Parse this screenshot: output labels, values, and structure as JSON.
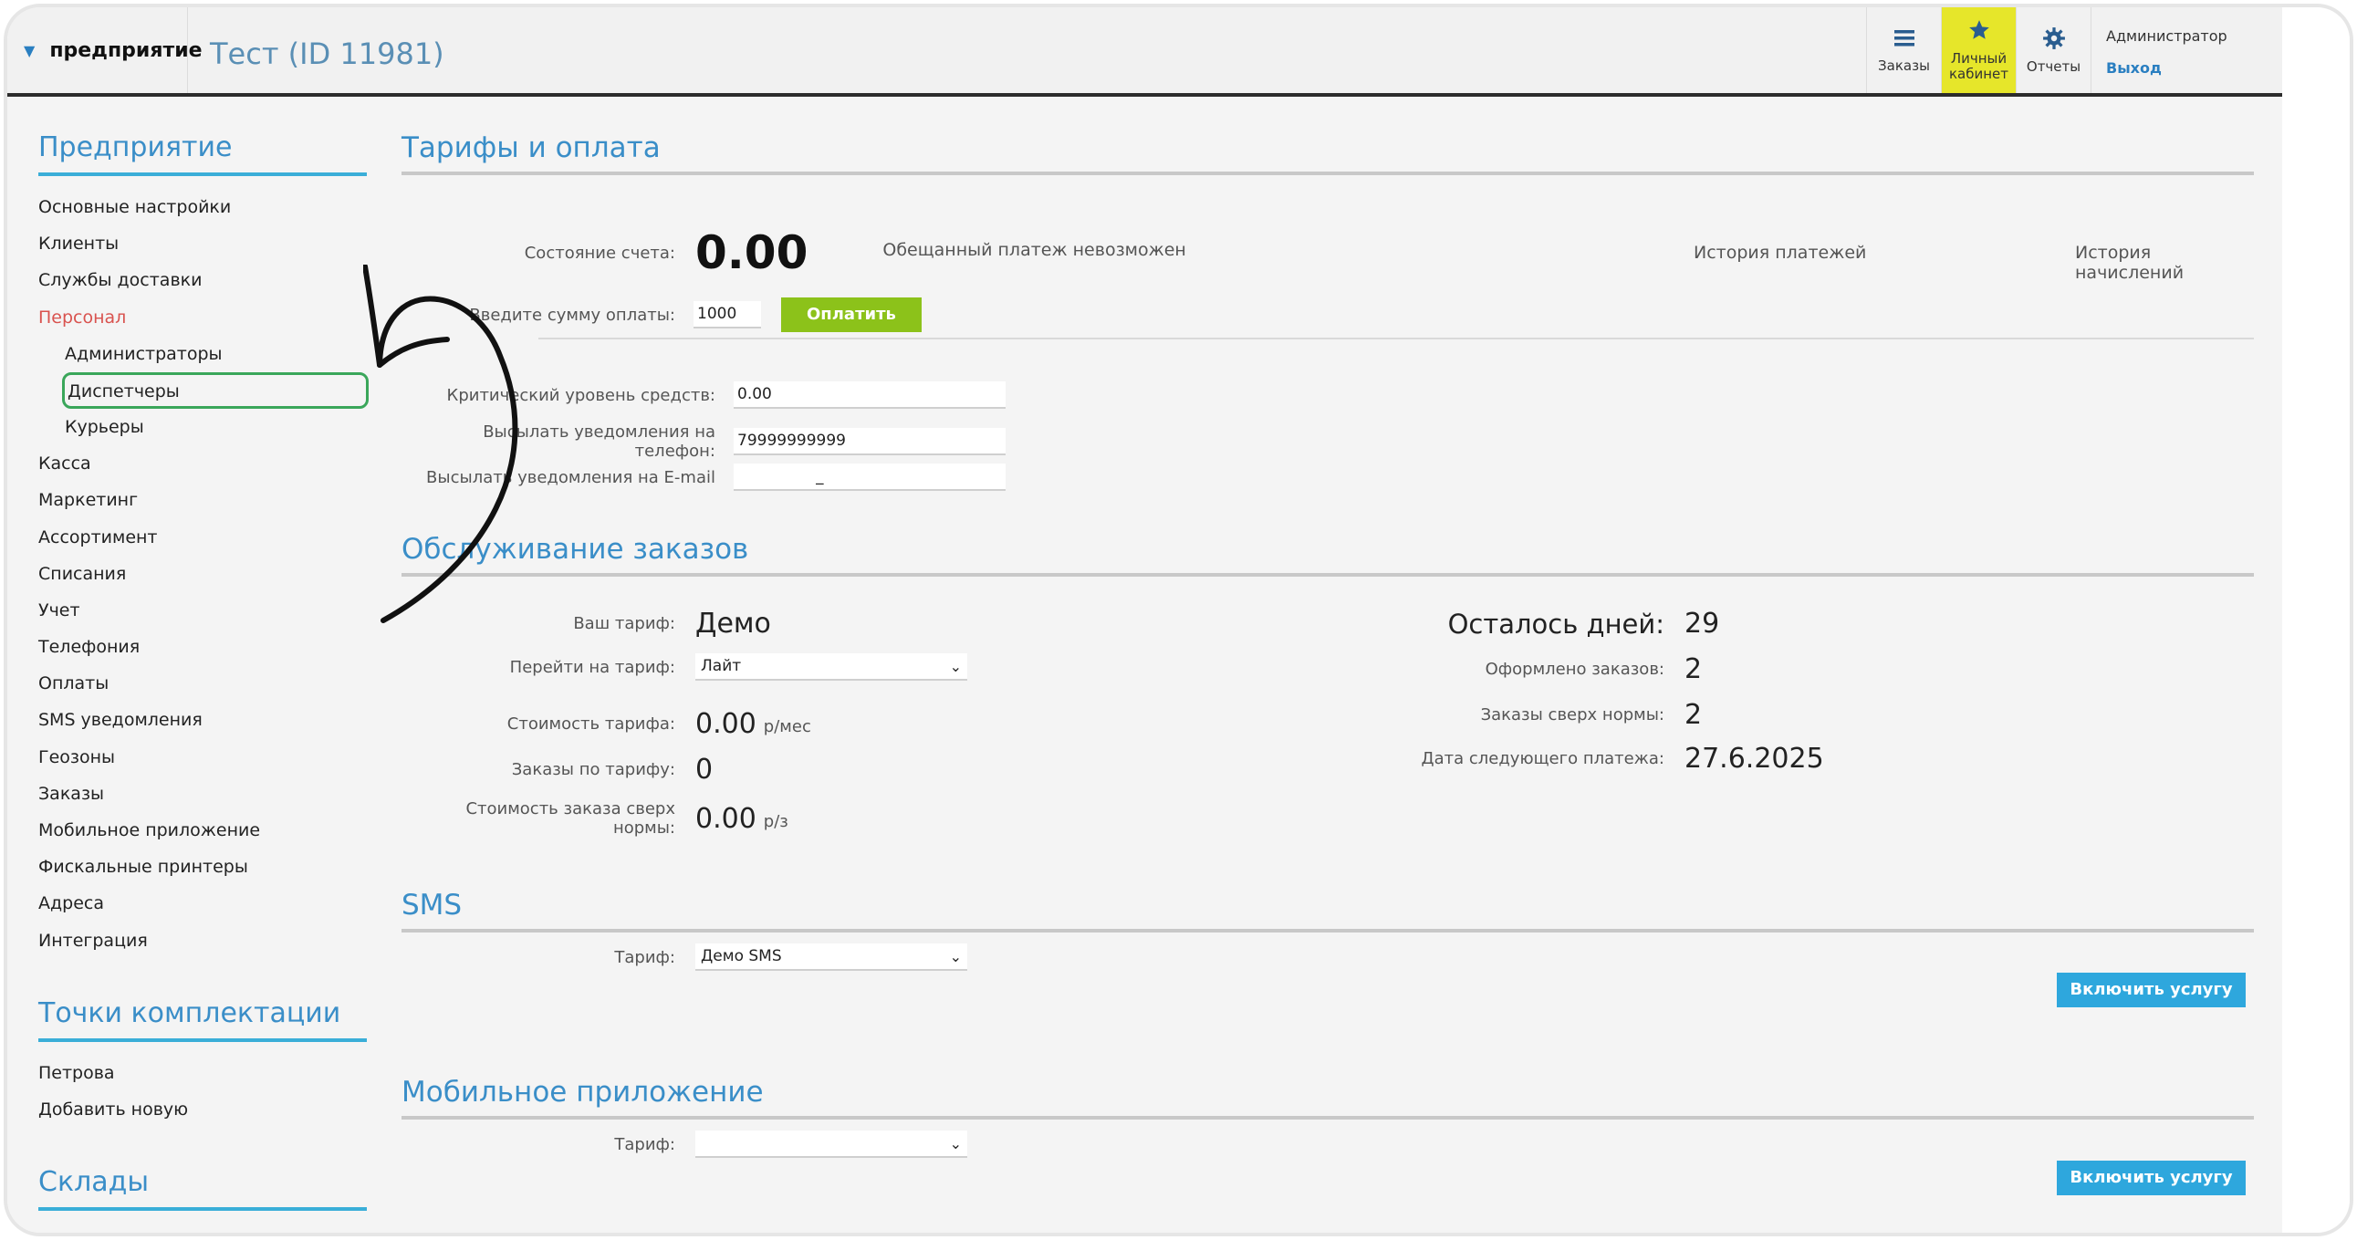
{
  "header": {
    "company": "предприятие",
    "project_title": "Тест (ID 11981)",
    "nav": [
      {
        "label": "Заказы",
        "icon": "menu-icon"
      },
      {
        "label": "Личный кабинет",
        "icon": "star-icon"
      },
      {
        "label": "Отчеты",
        "icon": "gear-icon"
      }
    ],
    "user": "Администратор",
    "logout": "Выход"
  },
  "sidebar": {
    "enterprise_title": "Предприятие",
    "items": [
      "Основные настройки",
      "Клиенты",
      "Службы доставки",
      "Персонал",
      "Администраторы",
      "Диспетчеры",
      "Курьеры",
      "Касса",
      "Маркетинг",
      "Ассортимент",
      "Списания",
      "Учет",
      "Телефония",
      "Оплаты",
      "SMS уведомления",
      "Геозоны",
      "Заказы",
      "Мобильное приложение",
      "Фискальные принтеры",
      "Адреса",
      "Интеграция"
    ],
    "points_title": "Точки комплектации",
    "points": [
      "Петрова",
      "Добавить новую"
    ],
    "warehouses_title": "Склады"
  },
  "tariffs": {
    "title": "Тарифы и оплата",
    "balance_label": "Состояние счета:",
    "balance": "0.00",
    "promised": "Обещанный платеж невозможен",
    "history_payments": "История платежей",
    "history_charges": "История начислений",
    "pay_label": "Введите сумму оплаты:",
    "pay_value": "1000",
    "pay_button": "Оплатить",
    "critical_label": "Критический уровень средств:",
    "critical_value": "0.00",
    "phone_label": "Высылать уведомления на телефон:",
    "phone_value": "79999999999",
    "email_label": "Высылать уведомления на E-mail",
    "email_value": "_"
  },
  "service": {
    "title": "Обслуживание заказов",
    "tariff_label": "Ваш тариф:",
    "tariff": "Демо",
    "switch_label": "Перейти на тариф:",
    "switch_value": "Лайт",
    "cost_label": "Стоимость тарифа:",
    "cost": "0.00",
    "cost_unit": "р/мес",
    "orders_label": "Заказы по тарифу:",
    "orders": "0",
    "extra_cost_label": "Стоимость заказа сверх нормы:",
    "extra_cost": "0.00",
    "extra_cost_unit": "р/з",
    "days_left_label": "Осталось дней:",
    "days_left": "29",
    "placed_label": "Оформлено заказов:",
    "placed": "2",
    "over_label": "Заказы сверх нормы:",
    "over": "2",
    "next_payment_label": "Дата следующего платежа:",
    "next_payment": "27.6.2025"
  },
  "sms": {
    "title": "SMS",
    "tariff_label": "Тариф:",
    "tariff_value": "Демо SMS",
    "enable": "Включить услугу"
  },
  "mobile": {
    "title": "Мобильное приложение",
    "tariff_label": "Тариф:",
    "tariff_value": "",
    "enable": "Включить услугу"
  },
  "colors": {
    "accent": "#3a8ec8",
    "active_nav": "#e6e62a",
    "pay_button": "#8cc21a",
    "enable_button": "#2ea7dd",
    "highlight_box": "#3aa65a"
  }
}
